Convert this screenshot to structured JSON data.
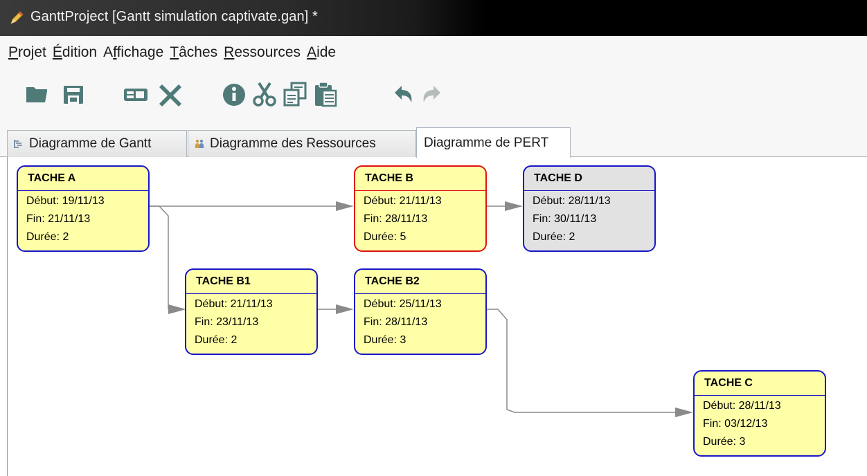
{
  "window": {
    "title": "GanttProject [Gantt simulation captivate.gan] *"
  },
  "menu": [
    {
      "mnemonic": "P",
      "rest": "rojet"
    },
    {
      "mnemonic": "É",
      "rest": "dition"
    },
    {
      "pre": "A",
      "mnemonic": "f",
      "rest": "fichage"
    },
    {
      "mnemonic": "T",
      "rest": "âches"
    },
    {
      "mnemonic": "R",
      "rest": "essources"
    },
    {
      "mnemonic": "A",
      "rest": "ide"
    }
  ],
  "toolbar": {
    "icons": [
      "open-folder-icon",
      "save-icon",
      "task-properties-icon",
      "delete-icon",
      "info-icon",
      "cut-icon",
      "copy-icon",
      "paste-icon",
      "undo-icon",
      "redo-icon"
    ]
  },
  "tabs": [
    {
      "label": "Diagramme de Gantt",
      "icon": "gantt-chart-icon",
      "active": false
    },
    {
      "label": "Diagramme des Ressources",
      "icon": "resources-icon",
      "active": false
    },
    {
      "label": "Diagramme de PERT",
      "active": true
    }
  ],
  "pert": {
    "colors": {
      "node_fill": "#ffffa8",
      "node_border": "#1616c8",
      "critical_border": "#e01010",
      "done_fill": "#e2e2e2",
      "link": "#8a8a8a"
    },
    "nodes": [
      {
        "id": "A",
        "title": "TACHE A",
        "start": "Début: 19/11/13",
        "end": "Fin: 21/11/13",
        "duration": "Durée: 2",
        "critical": false,
        "done": false
      },
      {
        "id": "B",
        "title": "TACHE B",
        "start": "Début: 21/11/13",
        "end": "Fin: 28/11/13",
        "duration": "Durée: 5",
        "critical": true,
        "done": false
      },
      {
        "id": "D",
        "title": "TACHE D",
        "start": "Début: 28/11/13",
        "end": "Fin: 30/11/13",
        "duration": "Durée: 2",
        "critical": false,
        "done": true
      },
      {
        "id": "B1",
        "title": "TACHE B1",
        "start": "Début: 21/11/13",
        "end": "Fin: 23/11/13",
        "duration": "Durée: 2",
        "critical": false,
        "done": false
      },
      {
        "id": "B2",
        "title": "TACHE B2",
        "start": "Début: 25/11/13",
        "end": "Fin: 28/11/13",
        "duration": "Durée: 3",
        "critical": false,
        "done": false
      },
      {
        "id": "C",
        "title": "TACHE C",
        "start": "Début: 28/11/13",
        "end": "Fin: 03/12/13",
        "duration": "Durée: 3",
        "critical": false,
        "done": false
      }
    ],
    "links": [
      {
        "from": "A",
        "to": "B"
      },
      {
        "from": "A",
        "to": "B1"
      },
      {
        "from": "B1",
        "to": "B2"
      },
      {
        "from": "B",
        "to": "D"
      },
      {
        "from": "B2",
        "to": "C"
      }
    ]
  }
}
